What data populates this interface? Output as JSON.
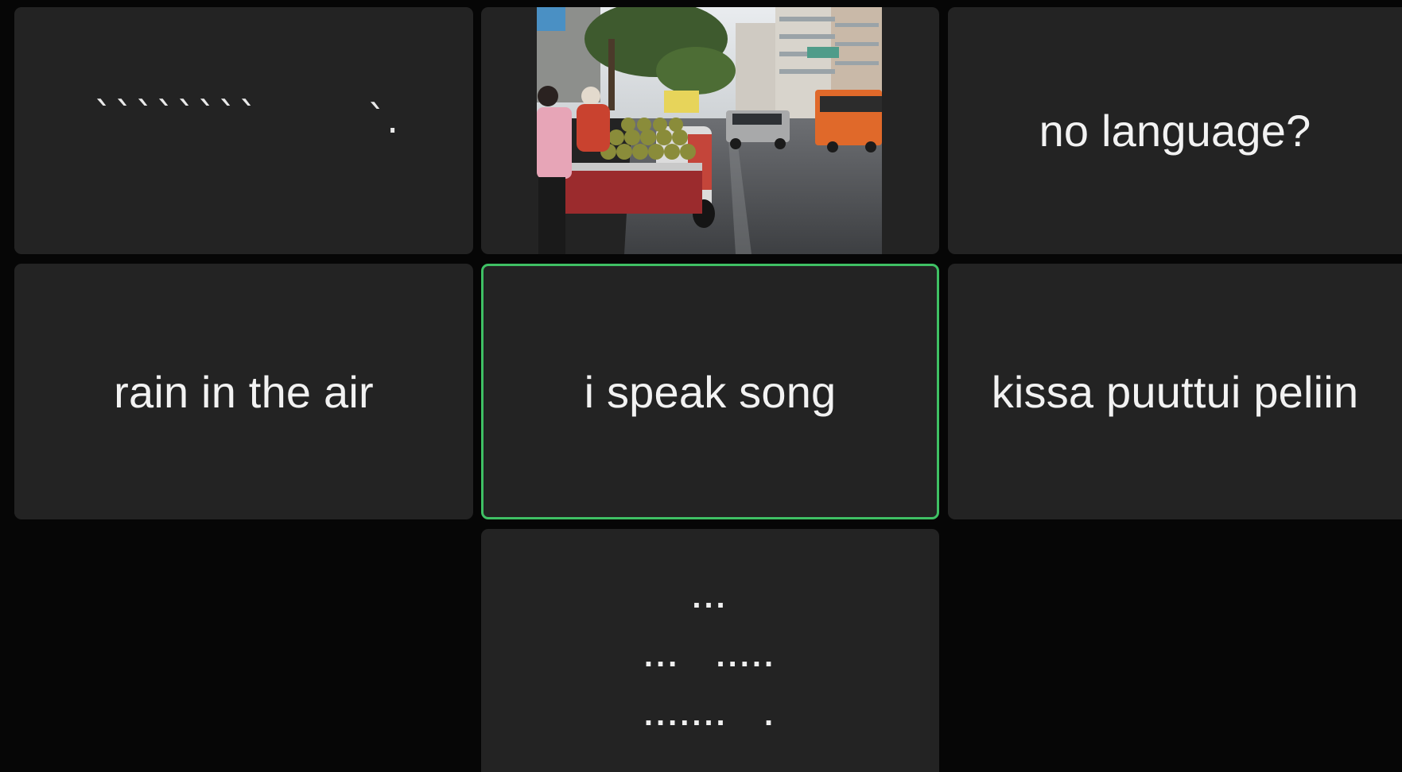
{
  "tiles": {
    "top_left": {
      "marks": [
        "`",
        "`",
        "`",
        "`",
        "`",
        "`",
        "`",
        "`",
        "`."
      ]
    },
    "top_middle": {
      "image": "street-market-photo"
    },
    "top_right": {
      "caption": "no language?"
    },
    "mid_left": {
      "caption": "rain in the air"
    },
    "mid_center": {
      "caption": "i speak song",
      "active": true
    },
    "mid_right": {
      "caption": "kissa puuttui peliin"
    },
    "bottom_middle": {
      "lines": [
        "...",
        "...   .....",
        ".......   ."
      ]
    }
  },
  "colors": {
    "tile_background": "#232323",
    "page_background": "#060606",
    "active_border": "#3fc064",
    "caption_text": "#f2f2f2"
  }
}
